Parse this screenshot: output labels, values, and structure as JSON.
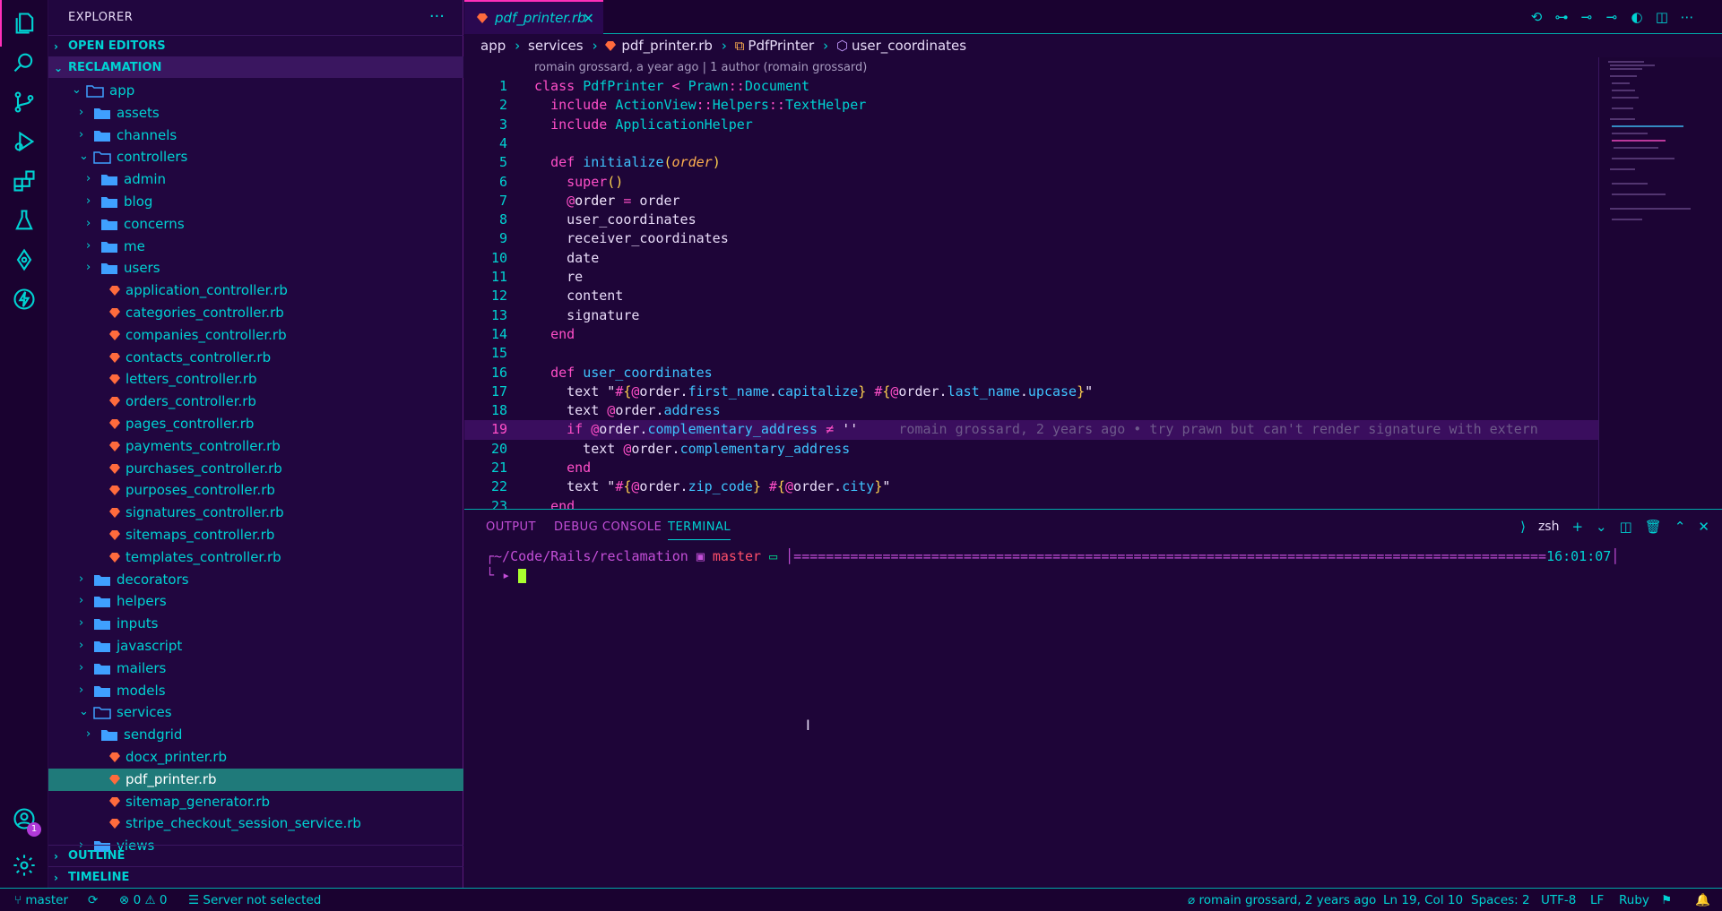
{
  "activity_bar": {
    "items": [
      "explorer-icon",
      "search-icon",
      "source-control-icon",
      "run-debug-icon",
      "extensions-icon",
      "testing-icon",
      "gitlens-icon",
      "thunder-icon"
    ],
    "bottom": [
      "account-icon",
      "settings-icon"
    ],
    "account_badge": "1"
  },
  "sidebar": {
    "title": "EXPLORER",
    "more": "···",
    "sections": {
      "open_editors": "OPEN EDITORS",
      "project": "RECLAMATION",
      "outline": "OUTLINE",
      "timeline": "TIMELINE"
    },
    "tree": [
      {
        "label": "app",
        "type": "folder-open"
      },
      {
        "label": "assets",
        "type": "folder"
      },
      {
        "label": "channels",
        "type": "folder"
      },
      {
        "label": "controllers",
        "type": "folder-open"
      },
      {
        "label": "admin",
        "type": "folder"
      },
      {
        "label": "blog",
        "type": "folder"
      },
      {
        "label": "concerns",
        "type": "folder"
      },
      {
        "label": "me",
        "type": "folder"
      },
      {
        "label": "users",
        "type": "folder"
      },
      {
        "label": "application_controller.rb",
        "type": "ruby"
      },
      {
        "label": "categories_controller.rb",
        "type": "ruby"
      },
      {
        "label": "companies_controller.rb",
        "type": "ruby"
      },
      {
        "label": "contacts_controller.rb",
        "type": "ruby"
      },
      {
        "label": "letters_controller.rb",
        "type": "ruby"
      },
      {
        "label": "orders_controller.rb",
        "type": "ruby"
      },
      {
        "label": "pages_controller.rb",
        "type": "ruby"
      },
      {
        "label": "payments_controller.rb",
        "type": "ruby"
      },
      {
        "label": "purchases_controller.rb",
        "type": "ruby"
      },
      {
        "label": "purposes_controller.rb",
        "type": "ruby"
      },
      {
        "label": "signatures_controller.rb",
        "type": "ruby"
      },
      {
        "label": "sitemaps_controller.rb",
        "type": "ruby"
      },
      {
        "label": "templates_controller.rb",
        "type": "ruby"
      },
      {
        "label": "decorators",
        "type": "folder"
      },
      {
        "label": "helpers",
        "type": "folder"
      },
      {
        "label": "inputs",
        "type": "folder"
      },
      {
        "label": "javascript",
        "type": "folder"
      },
      {
        "label": "mailers",
        "type": "folder"
      },
      {
        "label": "models",
        "type": "folder"
      },
      {
        "label": "services",
        "type": "folder-open"
      },
      {
        "label": "sendgrid",
        "type": "folder"
      },
      {
        "label": "docx_printer.rb",
        "type": "ruby"
      },
      {
        "label": "pdf_printer.rb",
        "type": "ruby",
        "selected": true
      },
      {
        "label": "sitemap_generator.rb",
        "type": "ruby"
      },
      {
        "label": "stripe_checkout_session_service.rb",
        "type": "ruby"
      },
      {
        "label": "views",
        "type": "folder"
      }
    ]
  },
  "tabs": [
    {
      "label": "pdf_printer.rb",
      "close": "✕"
    }
  ],
  "tab_actions": [
    "history-icon",
    "git-compare-icon",
    "previous-change-icon",
    "next-change-icon",
    "gitlens-toggle-icon",
    "split-editor-icon",
    "more-actions-icon"
  ],
  "breadcrumb": [
    "app",
    "services",
    "pdf_printer.rb",
    "PdfPrinter",
    "user_coordinates"
  ],
  "codelens": "romain grossard, a year ago | 1 author (romain grossard)",
  "code_lines": [
    {
      "n": "1"
    },
    {
      "n": "2"
    },
    {
      "n": "3"
    },
    {
      "n": "4"
    },
    {
      "n": "5"
    },
    {
      "n": "6"
    },
    {
      "n": "7"
    },
    {
      "n": "8"
    },
    {
      "n": "9"
    },
    {
      "n": "10"
    },
    {
      "n": "11"
    },
    {
      "n": "12"
    },
    {
      "n": "13"
    },
    {
      "n": "14"
    },
    {
      "n": "15"
    },
    {
      "n": "16"
    },
    {
      "n": "17"
    },
    {
      "n": "18"
    },
    {
      "n": "19"
    },
    {
      "n": "20"
    },
    {
      "n": "21"
    },
    {
      "n": "22"
    },
    {
      "n": "23"
    }
  ],
  "blame_inline": "romain grossard, 2 years ago • try prawn but can't render signature with extern",
  "panel": {
    "tabs": [
      "OUTPUT",
      "DEBUG CONSOLE",
      "TERMINAL"
    ],
    "shell": "zsh",
    "terminal": {
      "path": "~/Code/Rails/reclamation",
      "branch": "master",
      "time": "16:01:07",
      "prompt": "▸"
    }
  },
  "status": {
    "branch": "master",
    "errors": "0",
    "warnings": "0",
    "server": "Server not selected",
    "blame": "romain grossard, 2 years ago",
    "position": "Ln 19, Col 10",
    "spaces": "Spaces: 2",
    "encoding": "UTF-8",
    "eol": "LF",
    "language": "Ruby"
  },
  "colors": {
    "accent": "#00d2d2",
    "pink": "#ff2fb9",
    "background": "#1e0538",
    "selection": "#1f7a7a"
  }
}
